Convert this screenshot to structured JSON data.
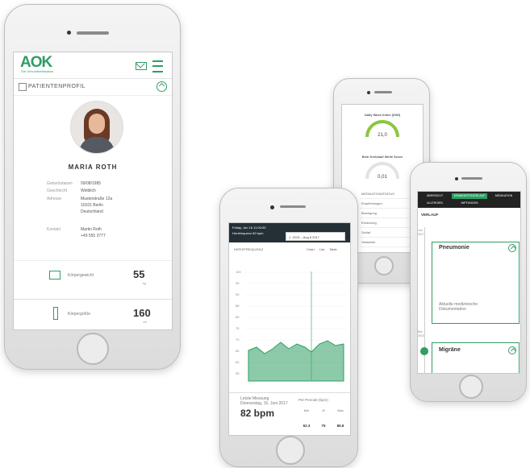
{
  "brand": {
    "logo": "AOK",
    "sub": "Die Gesundheitskasse."
  },
  "profile": {
    "section_title": "PATIENTENPROFIL",
    "name": "MARIA ROTH",
    "fields": [
      {
        "label": "Geburtsdatum",
        "value": "09/08/1985"
      },
      {
        "label": "Geschlecht",
        "value": "Weiblich"
      },
      {
        "label": "Adresse",
        "value": "Musterstraße 12a"
      },
      {
        "label": "",
        "value": "10101 Berlin"
      },
      {
        "label": "",
        "value": "Deutschland"
      },
      {
        "label": "Kontakt",
        "value": "Martin Roth"
      },
      {
        "label": "",
        "value": "+49 555 3777"
      }
    ],
    "weight": {
      "label": "Körpergewicht",
      "value": "55",
      "unit": "kg"
    },
    "height": {
      "label": "Körpergröße",
      "value": "160",
      "unit": "cm"
    }
  },
  "gauges": {
    "g1": {
      "title": "Daily Wave Index (DWI)",
      "value": "21,0",
      "level": 0.6
    },
    "g2": {
      "title": "Bein Kreislauf Welle Score",
      "value": "0,01",
      "level": 0.0
    },
    "rows": [
      "MEDIKATION/STATUS",
      "Empfehlungen",
      "Bewegung",
      "Ernährung",
      "Schlaf",
      "Vitalwerte"
    ]
  },
  "history": {
    "tabs": [
      "ÜBERSICHT",
      "KRANKHEITSVERLAUF",
      "MEDIKATION",
      "ALLERGIEN",
      "IMPFUNGEN"
    ],
    "heading": "VERLAUF",
    "entry1": {
      "date_top": "Jun",
      "date_bottom": "2017",
      "title": "Pneumonie",
      "link": "Aktuelle medizinische Dokumentation"
    },
    "entry2": {
      "date_top": "Mrz",
      "date_bottom": "2015",
      "title": "Migräne"
    }
  },
  "heart": {
    "header_line1": "Friday, Jun 16 11:00:00",
    "header_line2": "Herzfrequenz  82 bpm",
    "date_range": "1. 2015 – Aug 8 2017",
    "chart_title": "HERZFREQUENZ",
    "options": [
      "Chart",
      "List",
      "Table"
    ],
    "latest_label": "Letzte Messung",
    "latest_date": "Donnerstag, 15. Juni 2017",
    "bpm": "82 bpm",
    "period_label": "Per Periode (bpm)",
    "stats": [
      {
        "label": "Min",
        "value": "62.3"
      },
      {
        "label": "Ø",
        "value": "75"
      },
      {
        "label": "Max",
        "value": "86.8"
      }
    ],
    "y_ticks": [
      "100",
      "95",
      "90",
      "85",
      "80",
      "75",
      "70",
      "65",
      "60",
      "55"
    ],
    "accent": "#2e9e63"
  }
}
